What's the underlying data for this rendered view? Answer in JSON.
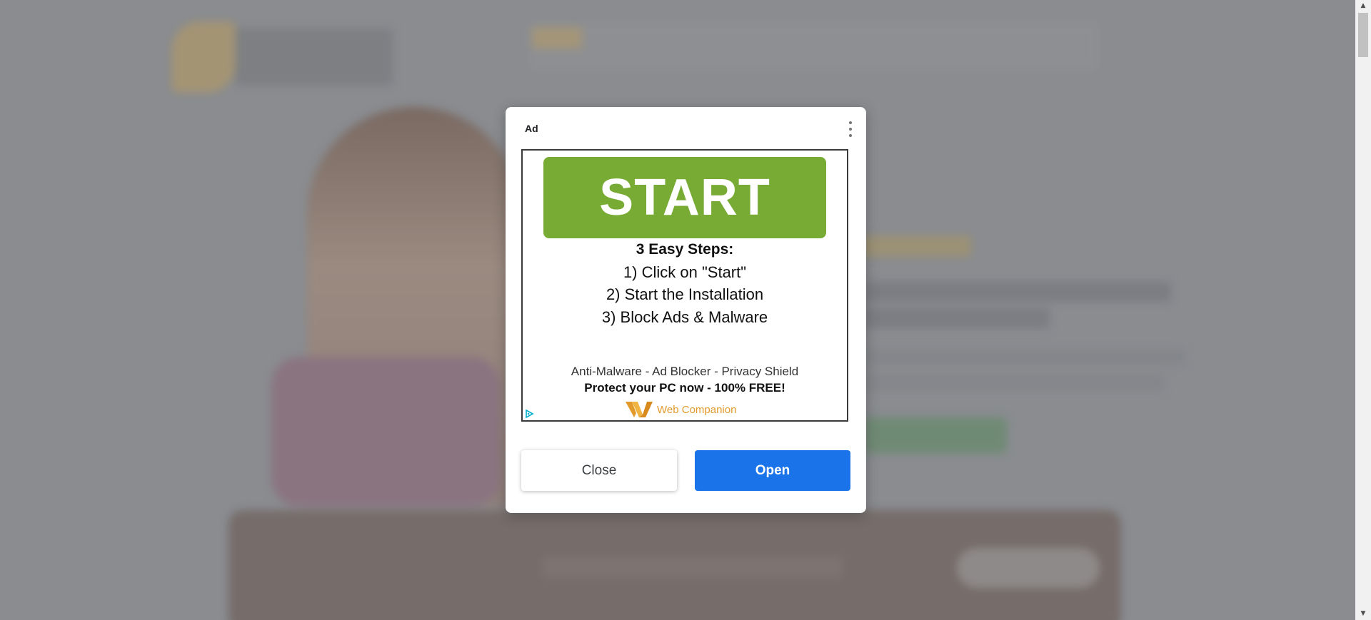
{
  "dialog": {
    "ad_label": "Ad",
    "more_icon": "more-vert-icon",
    "close_label": "Close",
    "open_label": "Open",
    "open_color": "#1a73e8"
  },
  "creative": {
    "start_label": "START",
    "start_color": "#78ab34",
    "steps_title": "3 Easy Steps:",
    "steps": [
      "1) Click on \"Start\"",
      "2) Start the Installation",
      "3) Block Ads & Malware"
    ],
    "tagline": "Anti-Malware - Ad Blocker - Privacy Shield",
    "protect": "Protect your PC now - 100% FREE!",
    "brand_name": "Web Companion",
    "brand_color": "#e29a2c",
    "adchoices_icon": "adchoices-icon"
  },
  "scrollbar": {
    "up_icon": "arrow-up-icon",
    "down_icon": "arrow-down-icon"
  }
}
